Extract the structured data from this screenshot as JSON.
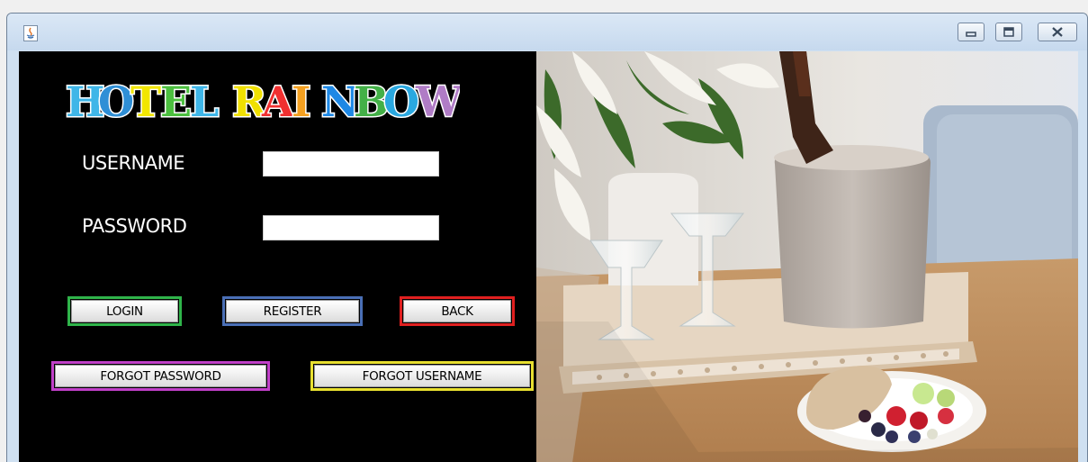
{
  "window": {
    "title": "",
    "controls": [
      "minimize-icon",
      "maximize-icon",
      "close-icon"
    ]
  },
  "logo": {
    "text": "HOTEL RAINBOW",
    "letter_colors": [
      "#3fb6e8",
      "#2f8fd6",
      "#f2e600",
      "#4cbf3f",
      "#3fb6e8",
      "#f0e000",
      "#f03030",
      "#f4a020",
      "#1e88e5",
      "#43b047",
      "#2aa8e0",
      "#b07cc6"
    ]
  },
  "form": {
    "username_label": "USERNAME",
    "username_value": "",
    "password_label": "PASSWORD",
    "password_value": ""
  },
  "buttons": {
    "login": "LOGIN",
    "register": "REGISTER",
    "back": "BACK",
    "forgot_password": "FORGOT PASSWORD",
    "forgot_username": "FORGOT USERNAME"
  },
  "colors": {
    "login_border": "#2fb44a",
    "register_border": "#4a6fb6",
    "back_border": "#e02020",
    "forgot_password_border": "#c040c8",
    "forgot_username_border": "#e8e030",
    "panel_bg": "#000000"
  }
}
